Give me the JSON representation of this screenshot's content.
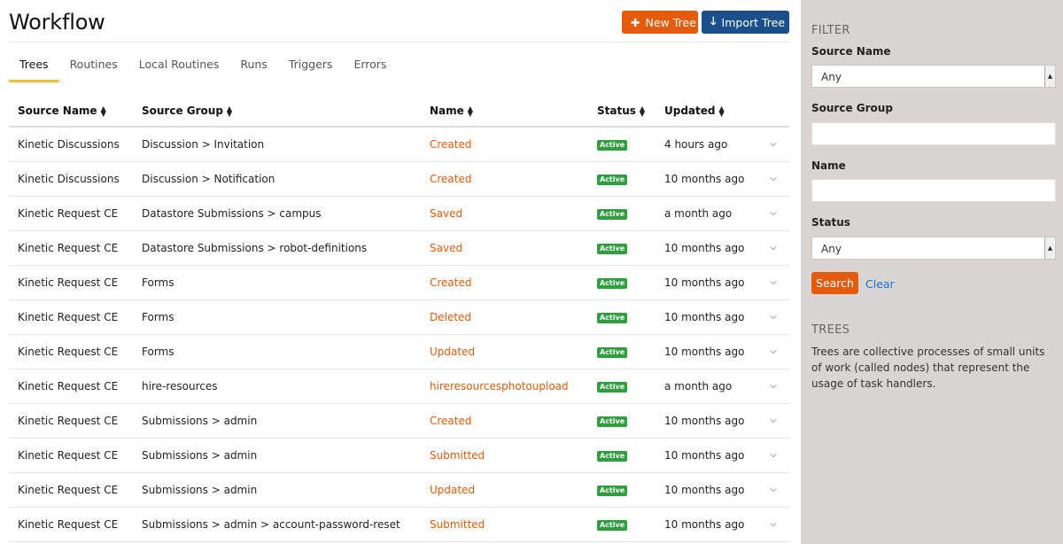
{
  "header": {
    "title": "Workflow"
  },
  "buttons": {
    "new_tree": "New Tree",
    "import_tree": "Import Tree"
  },
  "tabs": [
    {
      "label": "Trees",
      "active": true
    },
    {
      "label": "Routines"
    },
    {
      "label": "Local Routines"
    },
    {
      "label": "Runs"
    },
    {
      "label": "Triggers"
    },
    {
      "label": "Errors"
    }
  ],
  "table": {
    "columns": [
      "Source Name",
      "Source Group",
      "Name",
      "Status",
      "Updated"
    ],
    "rows": [
      {
        "source_name": "Kinetic Discussions",
        "source_group": "Discussion > Invitation",
        "name": "Created",
        "status": "Active",
        "updated": "4 hours ago"
      },
      {
        "source_name": "Kinetic Discussions",
        "source_group": "Discussion > Notification",
        "name": "Created",
        "status": "Active",
        "updated": "10 months ago"
      },
      {
        "source_name": "Kinetic Request CE",
        "source_group": "Datastore Submissions > campus",
        "name": "Saved",
        "status": "Active",
        "updated": "a month ago"
      },
      {
        "source_name": "Kinetic Request CE",
        "source_group": "Datastore Submissions > robot-definitions",
        "name": "Saved",
        "status": "Active",
        "updated": "10 months ago"
      },
      {
        "source_name": "Kinetic Request CE",
        "source_group": "Forms",
        "name": "Created",
        "status": "Active",
        "updated": "10 months ago"
      },
      {
        "source_name": "Kinetic Request CE",
        "source_group": "Forms",
        "name": "Deleted",
        "status": "Active",
        "updated": "10 months ago"
      },
      {
        "source_name": "Kinetic Request CE",
        "source_group": "Forms",
        "name": "Updated",
        "status": "Active",
        "updated": "10 months ago"
      },
      {
        "source_name": "Kinetic Request CE",
        "source_group": "hire-resources",
        "name": "hireresourcesphotoupload",
        "status": "Active",
        "updated": "a month ago"
      },
      {
        "source_name": "Kinetic Request CE",
        "source_group": "Submissions > admin",
        "name": "Created",
        "status": "Active",
        "updated": "10 months ago"
      },
      {
        "source_name": "Kinetic Request CE",
        "source_group": "Submissions > admin",
        "name": "Submitted",
        "status": "Active",
        "updated": "10 months ago"
      },
      {
        "source_name": "Kinetic Request CE",
        "source_group": "Submissions > admin",
        "name": "Updated",
        "status": "Active",
        "updated": "10 months ago"
      },
      {
        "source_name": "Kinetic Request CE",
        "source_group": "Submissions > admin > account-password-reset",
        "name": "Submitted",
        "status": "Active",
        "updated": "10 months ago"
      }
    ]
  },
  "sidebar": {
    "filter_heading": "FILTER",
    "source_name_label": "Source Name",
    "source_name_value": "Any",
    "source_group_label": "Source Group",
    "name_label": "Name",
    "status_label": "Status",
    "status_value": "Any",
    "search_label": "Search",
    "clear_label": "Clear",
    "trees_heading": "TREES",
    "trees_description": "Trees are collective processes of small units of work (called nodes) that represent the usage of task handlers."
  },
  "colors": {
    "accent": "#e35b0b",
    "primary": "#1b4f8a",
    "status_active": "#2e9e3e",
    "tab_underline": "#f0c23a",
    "sidebar_bg": "#d8d5d3"
  }
}
